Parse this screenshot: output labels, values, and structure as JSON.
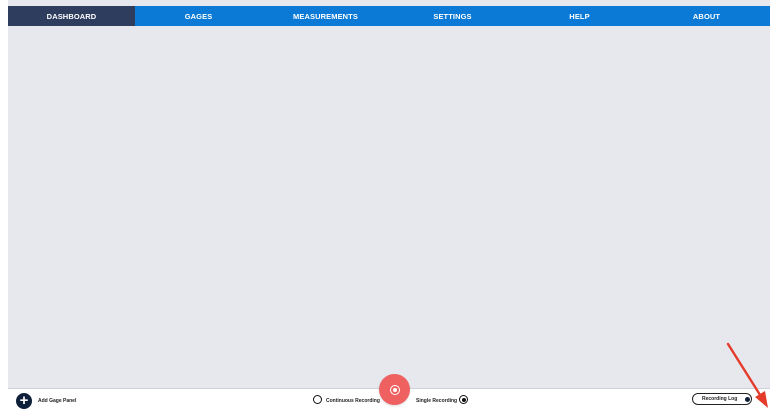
{
  "nav": {
    "items": [
      {
        "label": "DASHBOARD",
        "active": true
      },
      {
        "label": "GAGES",
        "active": false
      },
      {
        "label": "MEASUREMENTS",
        "active": false
      },
      {
        "label": "SETTINGS",
        "active": false
      },
      {
        "label": "HELP",
        "active": false
      },
      {
        "label": "ABOUT",
        "active": false
      }
    ]
  },
  "bottom": {
    "add_gage_panel": "Add Gage Panel",
    "continuous_recording": "Continuous Recording",
    "single_recording": "Single Recording",
    "recording_mode": "Single Recording",
    "recording_log": "Recording Log"
  },
  "icons": {
    "add": "plus-circle-icon",
    "record": "record-icon",
    "annotation": "red-arrow-icon"
  },
  "colors": {
    "nav_bg": "#0a7ad6",
    "nav_active": "#2e3d5e",
    "content_bg": "#e7e8ed",
    "record_btn": "#ef6161",
    "annotation_arrow": "#e43b2b"
  }
}
